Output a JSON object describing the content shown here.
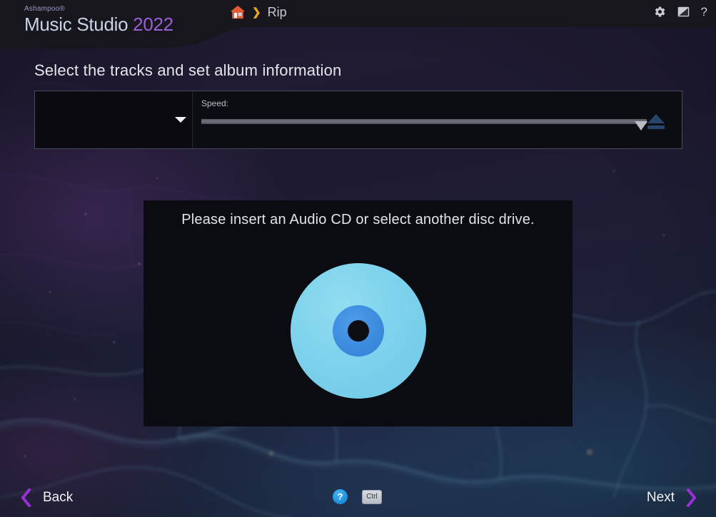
{
  "app": {
    "brand": "Ashampoo®",
    "product_part1": "Music Studio ",
    "product_part2": "2022"
  },
  "header": {
    "home_icon": "home-icon",
    "separator": "❯",
    "breadcrumb_current": "Rip",
    "tools": [
      {
        "name": "settings-gear-icon"
      },
      {
        "name": "theme-contrast-icon"
      },
      {
        "name": "help-question-icon",
        "glyph": "?"
      }
    ]
  },
  "page": {
    "title": "Select the tracks and set album information"
  },
  "toolbar": {
    "drive_selected": "",
    "drive_dropdown_icon": "chevron-down-icon",
    "speed_label": "Speed:",
    "speed_value": 100,
    "speed_min": 0,
    "speed_max": 100,
    "eject_icon": "eject-icon"
  },
  "message_panel": {
    "text": "Please insert an Audio CD or select another disc drive.",
    "disc_icon": "audio-cd-icon",
    "disc_outer_color": "#7ed2ec",
    "disc_inner_color": "#3b8ade",
    "disc_hole_color": "#0d0d14"
  },
  "footer": {
    "back_label": "Back",
    "next_label": "Next",
    "back_icon": "chevron-left-icon",
    "next_icon": "chevron-right-icon",
    "help_label": "?",
    "ctrl_label": "Ctrl",
    "chevron_color": "#9a2fd6",
    "help_color": "#1f93e0"
  },
  "theme": {
    "header_bg": "#16161c",
    "panel_bg": "#0b0b12",
    "panel_border": "#454a5c",
    "accent_purple": "#9a5fd6",
    "accent_amber": "#e8a81c"
  }
}
